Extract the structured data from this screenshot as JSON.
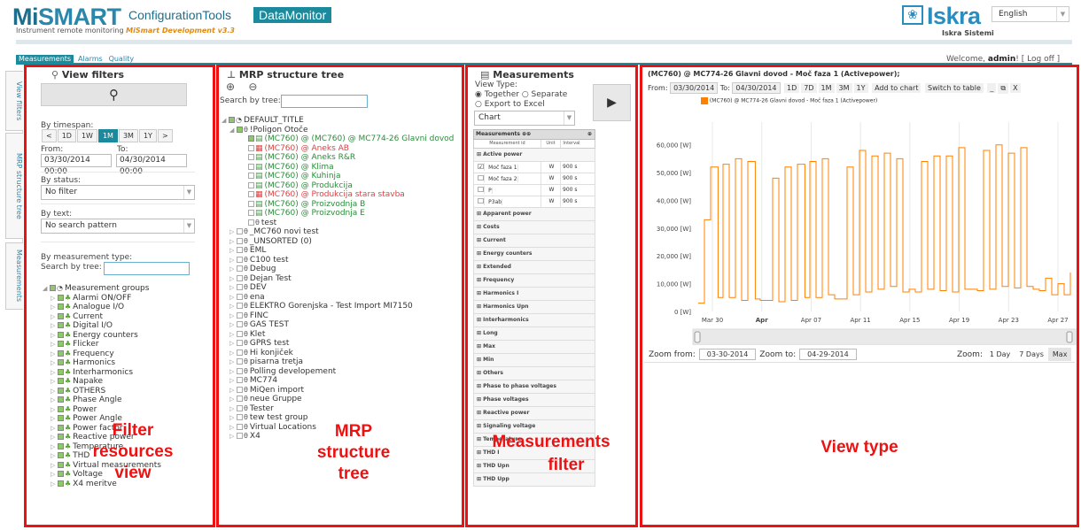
{
  "header": {
    "logo_mi": "Mi",
    "logo_smart": "SMART",
    "tabs": [
      "ConfigurationTools",
      "DataMonitor"
    ],
    "subtitle": "Instrument remote monitoring",
    "subtitle_dev": "MiSmart Development v3.3",
    "brand": "Iskra",
    "brand_sub": "Iskra Sistemi",
    "language": "English",
    "welcome_prefix": "Welcome, ",
    "welcome_user": "admin",
    "welcome_suffix": "! [",
    "logoff": "Log off",
    "close_bracket": "]"
  },
  "app_tabs": [
    "Measurements",
    "Alarms",
    "Quality"
  ],
  "side_tabs": [
    "View filters",
    "MRP structure tree",
    "Measurements"
  ],
  "view_filters": {
    "title": "View filters",
    "timespan_label": "By timespan:",
    "timespan_buttons": [
      "<",
      "1D",
      "1W",
      "1M",
      "3M",
      "1Y",
      ">"
    ],
    "active_timespan": "1M",
    "from_label": "From:",
    "to_label": "To:",
    "from_value": "03/30/2014 00:00",
    "to_value": "04/30/2014 00:00",
    "status_label": "By status:",
    "status_value": "No filter",
    "text_label": "By text:",
    "text_value": "No search pattern",
    "mtype_label": "By measurement type:",
    "search_tree_label": "Search by tree:",
    "groups_root": "Measurement groups",
    "groups": [
      "Alarmi ON/OFF",
      "Analogue I/O",
      "Current",
      "Digital I/O",
      "Energy counters",
      "Flicker",
      "Frequency",
      "Harmonics",
      "Interharmonics",
      "Napake",
      "OTHERS",
      "Phase Angle",
      "Power",
      "Power Angle",
      "Power factor",
      "Reactive power",
      "Temperature",
      "THD",
      "Virtual measurements",
      "Voltage",
      "X4 meritve"
    ],
    "overlay": [
      "Filter",
      "resources",
      "view"
    ]
  },
  "mrp": {
    "title": "MRP structure tree",
    "search_label": "Search by tree:",
    "root": "DEFAULT_TITLE",
    "polygon": "!Poligon Otoče",
    "devices": [
      {
        "label": "(MC760) @ (MC760) @ MC774-26 Glavni dovod",
        "color": "green",
        "checked": true
      },
      {
        "label": "(MC760) @ Aneks AB",
        "color": "red",
        "checked": false
      },
      {
        "label": "(MC760) @ Aneks R&R",
        "color": "green",
        "checked": false
      },
      {
        "label": "(MC760) @ Klima",
        "color": "green",
        "checked": false
      },
      {
        "label": "(MC760) @ Kuhinja",
        "color": "green",
        "checked": false
      },
      {
        "label": "(MC760) @ Produkcija",
        "color": "green",
        "checked": false
      },
      {
        "label": "(MC760) @ Produkcija stara stavba",
        "color": "red",
        "checked": false
      },
      {
        "label": "(MC760) @ Proizvodnja B",
        "color": "green",
        "checked": false
      },
      {
        "label": "(MC760) @ Proizvodnja E",
        "color": "green",
        "checked": false
      }
    ],
    "test_leaf": "test",
    "nodes": [
      "_MC760 novi test",
      "_UNSORTED (0)",
      "EML",
      "C100 test",
      "Debug",
      "Dejan Test",
      "DEV",
      "ena",
      "ELEKTRO Gorenjska - Test Import MI7150",
      "FINC",
      "GAS TEST",
      "Klet",
      "GPRS test",
      "Hi konjiček",
      "pisarna tretja",
      "Polling developement",
      "MC774",
      "MiQen import",
      "neue Gruppe",
      "Tester",
      "tew test group",
      "Virtual Locations",
      "X4"
    ],
    "overlay": [
      "MRP",
      "structure",
      "tree"
    ]
  },
  "measurements": {
    "title": "Measurements",
    "view_type_label": "View Type:",
    "together": "Together",
    "separate": "Separate",
    "export": "Export to Excel",
    "view_select": "Chart",
    "table_title": "Measurements",
    "cols": [
      "Measurement id",
      "Unit",
      "Interval"
    ],
    "active_group": "Active power",
    "rows": [
      {
        "name": "Moč faza 1",
        "unit": "W",
        "interval": "900 s",
        "checked": true
      },
      {
        "name": "Moč faza 2",
        "unit": "W",
        "interval": "900 s",
        "checked": false
      },
      {
        "name": "P",
        "unit": "W",
        "interval": "900 s",
        "checked": false
      },
      {
        "name": "P3ab",
        "unit": "W",
        "interval": "900 s",
        "checked": false
      }
    ],
    "groups": [
      "Apparent power",
      "Costs",
      "Current",
      "Energy counters",
      "Extended",
      "Frequency",
      "Harmonics I",
      "Harmonics Upn",
      "Interharmonics",
      "Long",
      "Max",
      "Min",
      "Others",
      "Phase to phase voltages",
      "Phase voltages",
      "Reactive power",
      "Signaling voltage",
      "Temperature",
      "THD I",
      "THD Upn",
      "THD Upp"
    ],
    "overlay": [
      "Measurements",
      "filter"
    ]
  },
  "view_type": {
    "title": "(MC760) @ MC774-26 Glavni dovod - Moč faza 1 (Activepower);",
    "from_label": "From:",
    "from_value": "03/30/2014",
    "to_label": "To:",
    "to_value": "04/30/2014",
    "range_buttons": [
      "1D",
      "7D",
      "1M",
      "3M",
      "1Y"
    ],
    "add_to_chart": "Add to chart",
    "switch_to_table": "Switch to table",
    "legend": "(MC760) @ MC774-26 Glavni dovod - Moč faza 1 (Activepower)",
    "zoom_from_label": "Zoom from:",
    "zoom_from_value": "03-30-2014",
    "zoom_to_label": "Zoom to:",
    "zoom_to_value": "04-29-2014",
    "zoom_label": "Zoom:",
    "zoom_buttons": [
      "1 Day",
      "7 Days",
      "Max"
    ],
    "active_zoom": "Max",
    "overlay": "View type"
  },
  "chart_data": {
    "type": "line",
    "series": [
      {
        "name": "(MC760) @ MC774-26 Glavni dovod - Moč faza 1 (Activepower)",
        "color": "#ff8000"
      }
    ],
    "y_ticks": [
      "0 [W]",
      "10,000 [W]",
      "20,000 [W]",
      "30,000 [W]",
      "40,000 [W]",
      "50,000 [W]",
      "60,000 [W]"
    ],
    "ylim": [
      0,
      65000
    ],
    "x_ticks": [
      "Mar 30",
      "Apr",
      "Apr 07",
      "Apr 11",
      "Apr 15",
      "Apr 19",
      "Apr 23",
      "Apr 27"
    ],
    "x": [
      0,
      0.5,
      1,
      1.6,
      2,
      2.5,
      3,
      3.5,
      4,
      4.6,
      5,
      5.5,
      6,
      6.5,
      7,
      7.5,
      8,
      8.6,
      9,
      9.5,
      10,
      10.5,
      11,
      11.5,
      12,
      12.5,
      13,
      13.5,
      14,
      14.5,
      15,
      15.5,
      16,
      16.5,
      17,
      17.5,
      18,
      18.5,
      19,
      19.5,
      20,
      20.5,
      21,
      21.5,
      22,
      22.5,
      23,
      23.5,
      24,
      24.5,
      25,
      25.5,
      26,
      26.5,
      27,
      27.5,
      28,
      28.5,
      29,
      29.5,
      30
    ],
    "values": [
      3000,
      33000,
      52000,
      5000,
      53000,
      5000,
      55000,
      4000,
      54000,
      4500,
      4000,
      4000,
      48000,
      3500,
      52000,
      4000,
      53000,
      5000,
      54000,
      5000,
      55000,
      6000,
      4500,
      4500,
      52000,
      6000,
      58000,
      7000,
      56000,
      8000,
      57000,
      9000,
      55000,
      7000,
      8000,
      7000,
      54000,
      8000,
      56000,
      7500,
      56000,
      7000,
      59000,
      8000,
      8000,
      7500,
      58000,
      8000,
      60000,
      9000,
      57000,
      8500,
      59000,
      9000,
      8000,
      7500,
      12000,
      6000,
      10000,
      6000,
      14000
    ]
  }
}
